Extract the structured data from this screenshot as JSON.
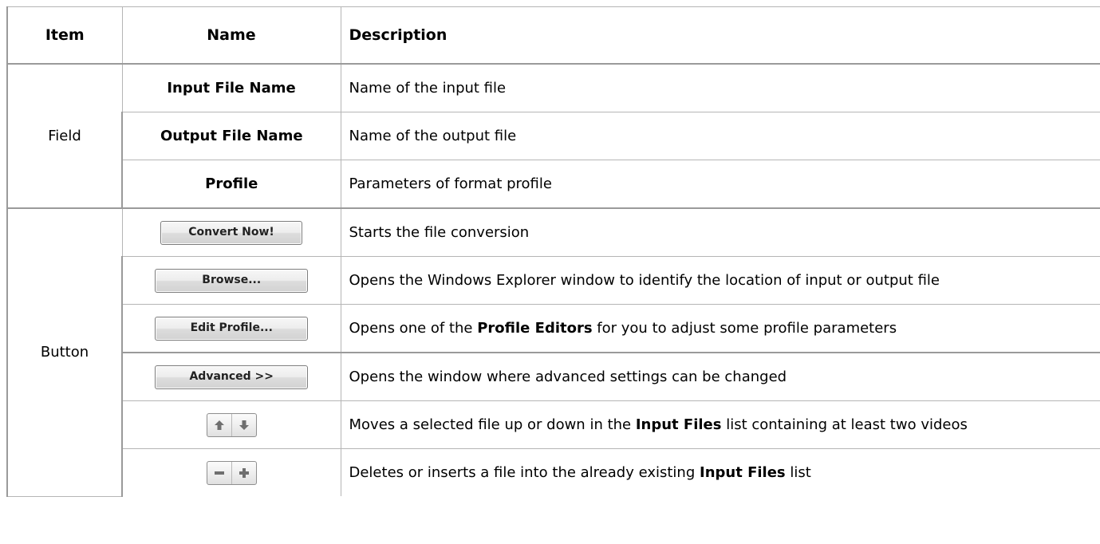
{
  "table": {
    "headers": {
      "item": "Item",
      "name": "Name",
      "description": "Description"
    },
    "field_group": {
      "item": "Field",
      "rows": [
        {
          "name": "Input File Name",
          "description": "Name of the input file"
        },
        {
          "name": "Output File Name",
          "description": "Name of the output file"
        },
        {
          "name": "Profile",
          "description": "Parameters of format profile"
        }
      ]
    },
    "button_group": {
      "item": "Button",
      "rows": [
        {
          "button_label": "Convert Now!",
          "description": "Starts the file conversion"
        },
        {
          "button_label": "Browse...",
          "description": "Opens the Windows Explorer window to identify the location of input or output file"
        },
        {
          "button_label": "Edit Profile...",
          "description_before": "Opens one of the ",
          "description_bold": "Profile Editors",
          "description_after": " for you to adjust some profile parameters"
        },
        {
          "button_label": "Advanced >>",
          "description": "Opens the window where advanced settings can be changed"
        },
        {
          "icons": [
            "arrow-up-icon",
            "arrow-down-icon"
          ],
          "description_before": "Moves a selected file up or down in the ",
          "description_bold": "Input Files",
          "description_after": " list containing at least two videos"
        },
        {
          "icons": [
            "minus-icon",
            "plus-icon"
          ],
          "description_before": "Deletes or inserts a file into the already existing ",
          "description_bold": "Input Files",
          "description_after": " list"
        }
      ]
    }
  },
  "colors": {
    "border": "#b5b5b5",
    "icon_gray": "#6f6f6f"
  }
}
